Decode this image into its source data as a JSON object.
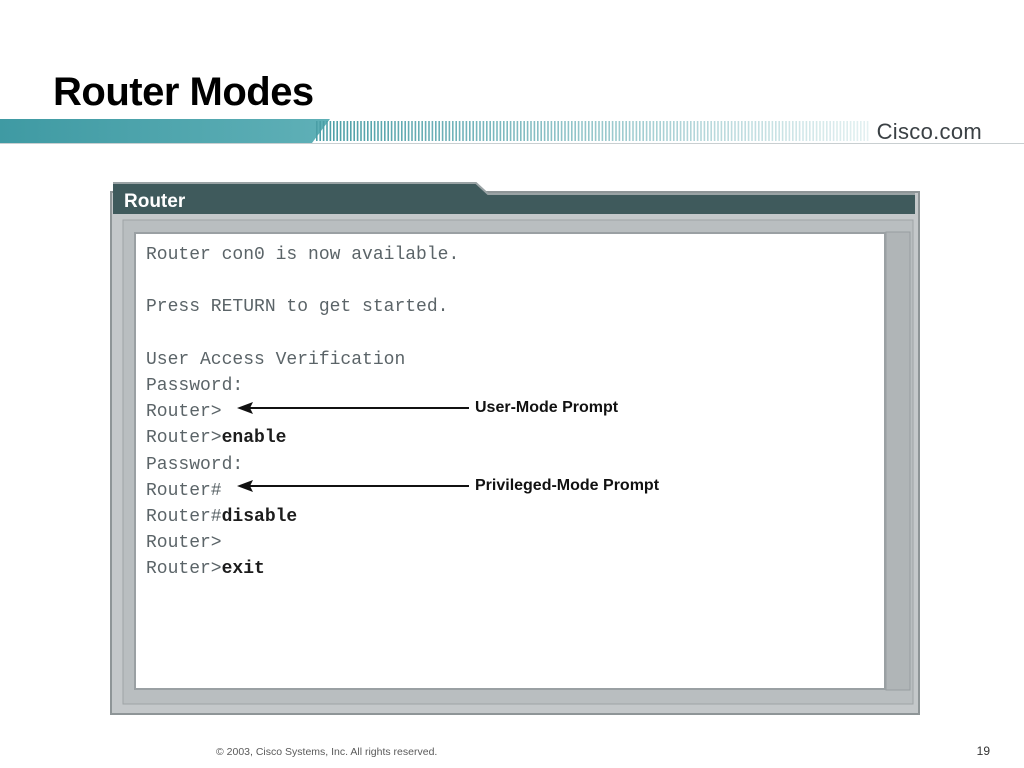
{
  "slide": {
    "title": "Router Modes",
    "brand": "Cisco.com",
    "footer": "© 2003, Cisco Systems, Inc. All rights reserved.",
    "page_number": "19"
  },
  "window": {
    "title": "Router"
  },
  "terminal": {
    "lines": [
      {
        "prompt": "Router con0 is now available.",
        "command": ""
      },
      {
        "prompt": "",
        "command": ""
      },
      {
        "prompt": "Press RETURN to get started.",
        "command": ""
      },
      {
        "prompt": "",
        "command": ""
      },
      {
        "prompt": "User Access Verification",
        "command": ""
      },
      {
        "prompt": "Password:",
        "command": ""
      },
      {
        "prompt": "Router>",
        "command": ""
      },
      {
        "prompt": "Router>",
        "command": "enable"
      },
      {
        "prompt": "Password:",
        "command": ""
      },
      {
        "prompt": "Router#",
        "command": ""
      },
      {
        "prompt": "Router#",
        "command": "disable"
      },
      {
        "prompt": "Router>",
        "command": ""
      },
      {
        "prompt": "Router>",
        "command": "exit"
      }
    ]
  },
  "annotations": {
    "user_mode": "User-Mode Prompt",
    "privileged_mode": "Privileged-Mode Prompt"
  },
  "colors": {
    "banner_teal": "#3f9aa3",
    "window_header": "#3f5a5c",
    "window_frame": "#c4c8ca",
    "terminal_text": "#5b6468"
  }
}
